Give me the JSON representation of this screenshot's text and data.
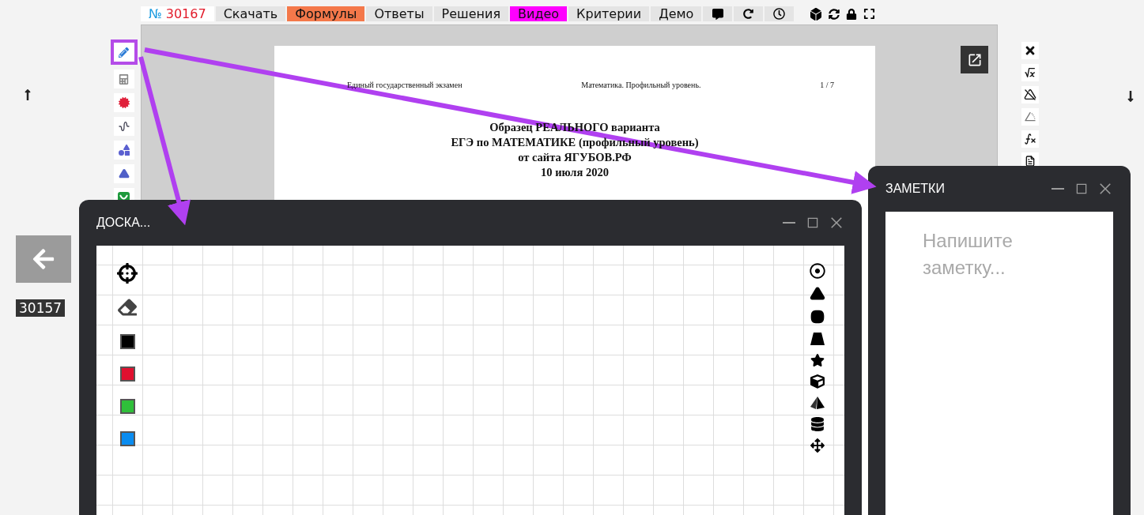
{
  "top_tabs": [
    {
      "kind": "number",
      "sign": "№",
      "label": "30167",
      "color": "#ffffff"
    },
    {
      "kind": "text",
      "label": "Скачать",
      "color": "#e4e4e4"
    },
    {
      "kind": "text",
      "label": "Формулы",
      "color": "#f4784a"
    },
    {
      "kind": "text",
      "label": "Ответы",
      "color": "#e4e4e4"
    },
    {
      "kind": "text",
      "label": "Решения",
      "color": "#e4e4e4"
    },
    {
      "kind": "text",
      "label": "Видео",
      "color": "#ff00ff"
    },
    {
      "kind": "text",
      "label": "Критерии",
      "color": "#e4e4e4"
    },
    {
      "kind": "text",
      "label": "Демо",
      "color": "#e4e4e4"
    }
  ],
  "left_tools": [
    {
      "highlighted": true
    },
    {
      "highlighted": false
    },
    {
      "highlighted": false
    },
    {
      "highlighted": false
    },
    {
      "highlighted": false
    },
    {
      "highlighted": false
    },
    {
      "highlighted": false
    }
  ],
  "left_nav": {
    "task_id": "30157"
  },
  "document": {
    "header_left": "Единый государственный экзамен",
    "header_center": "Математика. Профильный уровень.",
    "page": "1 / 7",
    "title_lines": [
      "Образец РЕАЛЬНОГО варианта",
      "ЕГЭ по МАТЕМАТИКЕ (профильный уровень)",
      "от сайта ЯГУБОВ.РФ",
      "10 июля 2020"
    ]
  },
  "board_window": {
    "title": "ДОСКА...",
    "colors": [
      {
        "color": "#000000"
      },
      {
        "color": "#e0102f"
      },
      {
        "color": "#2fbf3a"
      },
      {
        "color": "#0a8cf0"
      }
    ]
  },
  "notes_window": {
    "title": "ЗАМЕТКИ",
    "placeholder": "Напишите заметку..."
  }
}
